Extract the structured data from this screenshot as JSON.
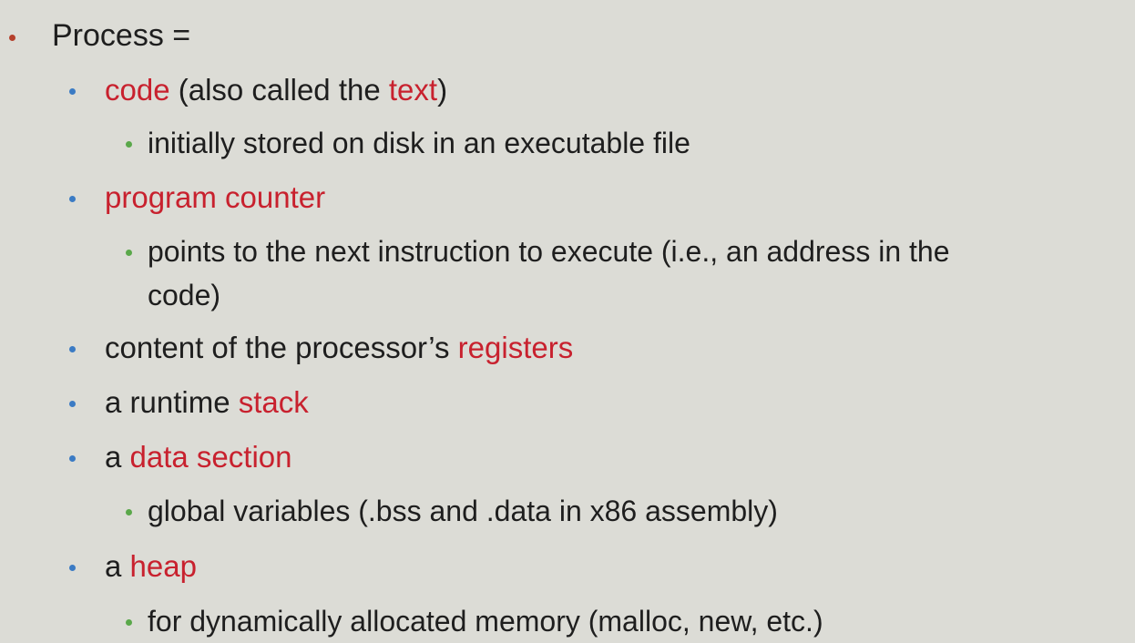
{
  "colors": {
    "highlight": "#c8212e",
    "bullet_level0": "#b5402c",
    "bullet_level1": "#3b7bc4",
    "bullet_level2": "#5aa84a",
    "text": "#1e1e1e",
    "background": "#dcdcd6"
  },
  "slide": {
    "heading": "Process =",
    "items": [
      {
        "pre": "",
        "term": "code",
        "post": " (also called the ",
        "term2": "text",
        "post2": ")"
      },
      {
        "sub": "initially stored on disk in an executable file"
      },
      {
        "term": "program counter"
      },
      {
        "sub_line1": "points to the next instruction to execute (i.e., an address in the",
        "sub_line2": "code)"
      },
      {
        "pre": "content of the processor’s ",
        "term": "registers"
      },
      {
        "pre": "a runtime ",
        "term": "stack"
      },
      {
        "pre": "a ",
        "term": "data section"
      },
      {
        "sub": "global variables (.bss and .data in x86 assembly)"
      },
      {
        "pre": "a ",
        "term": "heap"
      },
      {
        "sub": "for dynamically allocated memory (malloc, new, etc.)"
      }
    ]
  }
}
